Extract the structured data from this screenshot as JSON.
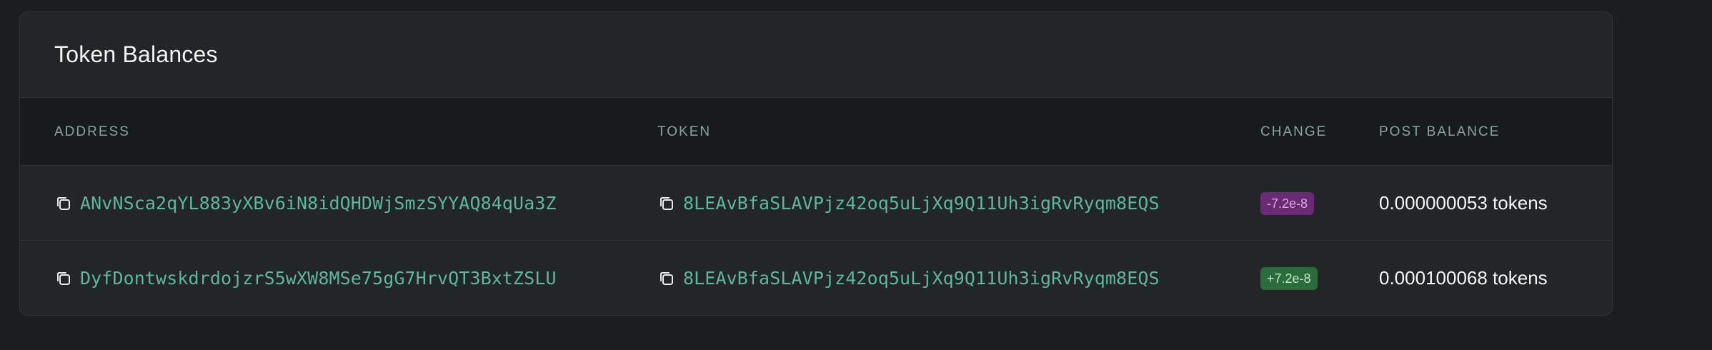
{
  "card": {
    "title": "Token Balances"
  },
  "table": {
    "headers": {
      "address": "ADDRESS",
      "token": "TOKEN",
      "change": "CHANGE",
      "post_balance": "POST BALANCE"
    },
    "rows": [
      {
        "address": "ANvNSca2qYL883yXBv6iN8idQHDWjSmzSYYAQ84qUa3Z",
        "token": "8LEAvBfaSLAVPjz42oq5uLjXq9Q11Uh3igRvRyqm8EQS",
        "change": "-7.2e-8",
        "change_sign": "negative",
        "post_balance": "0.000000053 tokens"
      },
      {
        "address": "DyfDontwskdrdojzrS5wXW8MSe75gG7HrvQT3BxtZSLU",
        "token": "8LEAvBfaSLAVPjz42oq5uLjXq9Q11Uh3igRvRyqm8EQS",
        "change": "+7.2e-8",
        "change_sign": "positive",
        "post_balance": "0.000100068 tokens"
      }
    ]
  },
  "colors": {
    "background": "#1b1e1e",
    "card": "#222626",
    "link": "#5fb5a0",
    "badge_negative": "#6b2a73",
    "badge_positive": "#2c6b3c"
  },
  "icons": {
    "copy": "copy-icon"
  }
}
